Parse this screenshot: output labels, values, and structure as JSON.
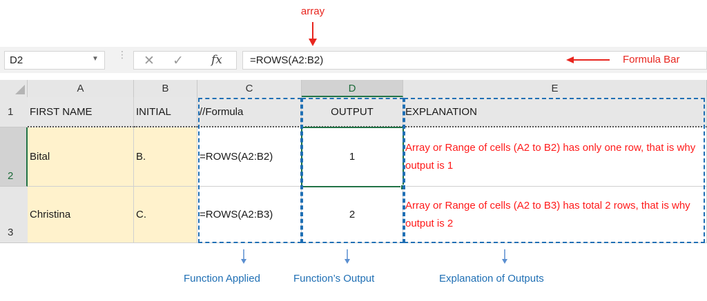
{
  "annotations": {
    "array": "array",
    "formula_bar": "Formula Bar",
    "function_applied": "Function Applied",
    "functions_output": "Function’s Output",
    "explanation_of_outputs": "Explanation of Outputs"
  },
  "formula_bar": {
    "name_box": "D2",
    "cancel_icon": "close-icon",
    "enter_icon": "check-icon",
    "fx_label": "fx",
    "formula": "=ROWS(A2:B2)"
  },
  "grid": {
    "columns": [
      "A",
      "B",
      "C",
      "D",
      "E"
    ],
    "selected_column": "D",
    "rows": [
      {
        "num": "1",
        "cells": [
          "FIRST NAME",
          "INITIAL",
          "//Formula",
          "OUTPUT",
          "EXPLANATION"
        ]
      },
      {
        "num": "2",
        "cells": [
          "Bital",
          "B.",
          "=ROWS(A2:B2)",
          "1",
          "Array or Range of cells (A2 to B2) has only one row, that is why output is 1"
        ]
      },
      {
        "num": "3",
        "cells": [
          "Christina",
          "C.",
          "=ROWS(A2:B3)",
          "2",
          "Array or Range of cells (A2 to B3) has total 2 rows, that is why output is 2"
        ]
      }
    ]
  },
  "colors": {
    "annotation_red": "#e8261f",
    "annotation_blue": "#1f6fb4",
    "selection_green": "#217346",
    "highlight_yellow": "#fff2cc"
  }
}
